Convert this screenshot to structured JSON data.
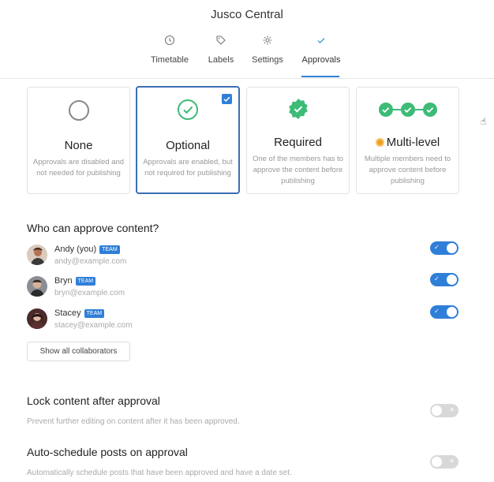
{
  "app": {
    "title": "Jusco Central"
  },
  "tabs": [
    {
      "label": "Timetable",
      "icon": "clock-icon"
    },
    {
      "label": "Labels",
      "icon": "tag-icon"
    },
    {
      "label": "Settings",
      "icon": "gear-icon"
    },
    {
      "label": "Approvals",
      "icon": "check-icon",
      "active": true
    }
  ],
  "approval_modes": [
    {
      "title": "None",
      "desc_line1": "Approvals are disabled and",
      "desc_line2": "not needed for publishing"
    },
    {
      "title": "Optional",
      "desc_line1": "Approvals are enabled, but",
      "desc_line2": "not required for publishing",
      "selected": true
    },
    {
      "title": "Required",
      "desc_line1": "One of the members has to",
      "desc_line2": "approve the content before",
      "desc_line3": "publishing"
    },
    {
      "title": "Multi-level",
      "desc_line1": "Multiple members need to",
      "desc_line2": "approve content before",
      "desc_line3": "publishing"
    }
  ],
  "approvers": {
    "title": "Who can approve content?",
    "people": [
      {
        "name": "Andy (you)",
        "badge": "TEAM",
        "email": "andy@example.com",
        "enabled": true
      },
      {
        "name": "Bryn",
        "badge": "TEAM",
        "email": "bryn@example.com",
        "enabled": true
      },
      {
        "name": "Stacey",
        "badge": "TEAM",
        "email": "stacey@example.com",
        "enabled": true
      }
    ],
    "show_all_label": "Show all collaborators"
  },
  "settings": [
    {
      "title": "Lock content after approval",
      "desc": "Prevent further editing on content after it has been approved.",
      "enabled": false
    },
    {
      "title": "Auto-schedule posts on approval",
      "desc": "Automatically schedule posts that have been approved and have a date set.",
      "enabled": false
    }
  ],
  "colors": {
    "accent": "#2f7fd8",
    "green": "#3dbb77",
    "selected_border": "#3a6fb5",
    "multi_dot": "#f0a020"
  }
}
